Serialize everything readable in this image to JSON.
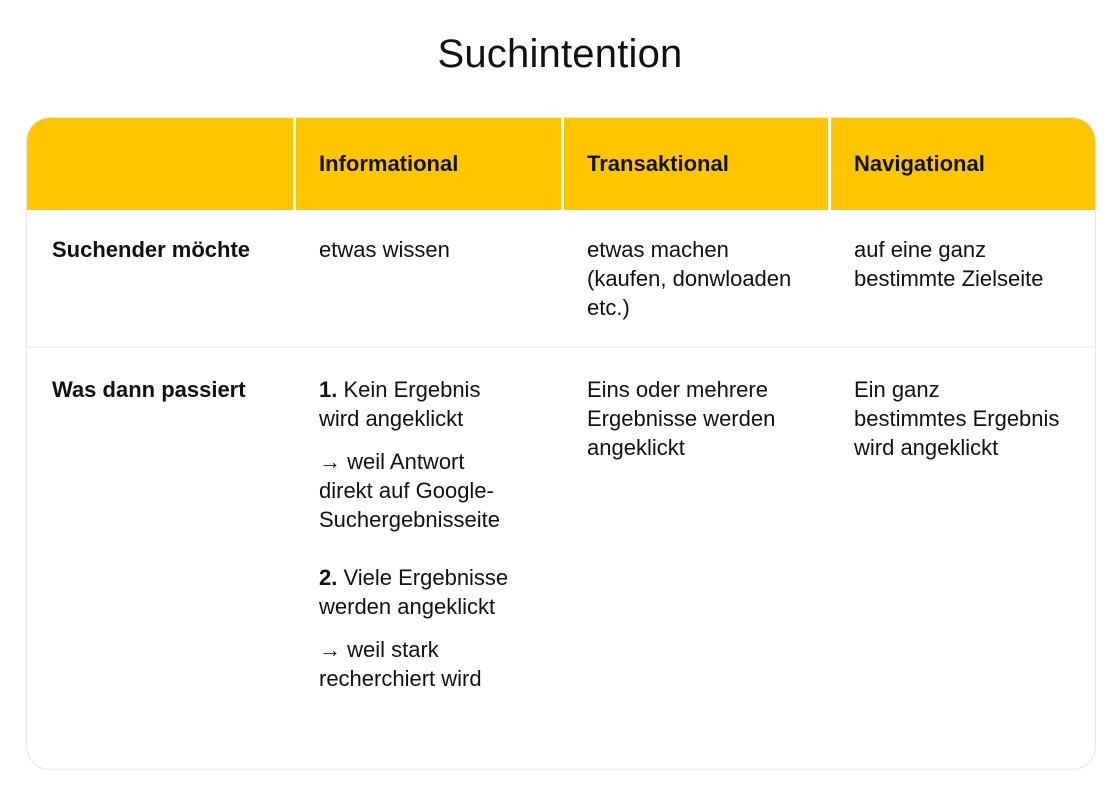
{
  "title": "Suchintention",
  "table": {
    "columns": [
      "",
      "Informational",
      "Transaktional",
      "Navigational"
    ],
    "rows": [
      {
        "label": "Suchender möchte",
        "cells": [
          [
            "etwas wissen"
          ],
          [
            "etwas machen",
            "(kaufen, donwloaden",
            "etc.)"
          ],
          [
            "auf eine ganz",
            "bestimmte Zielseite"
          ]
        ]
      },
      {
        "label": "Was dann passiert",
        "informational": {
          "item1_num": "1.",
          "item1_line1": " Kein Ergebnis",
          "item1_line2": "wird angeklickt",
          "item1_note": [
            "→ weil Antwort",
            "direkt auf Google-",
            "Suchergebnisseite"
          ],
          "item2_num": "2.",
          "item2_line1": " Viele Ergebnisse",
          "item2_line2": "werden angeklickt",
          "item2_note": [
            "→ weil stark",
            "recherchiert wird"
          ]
        },
        "transaktional": [
          "Eins oder mehrere",
          "Ergebnisse werden",
          "angeklickt"
        ],
        "navigational": [
          "Ein ganz",
          "bestimmtes Ergebnis",
          "wird angeklickt"
        ]
      }
    ]
  }
}
